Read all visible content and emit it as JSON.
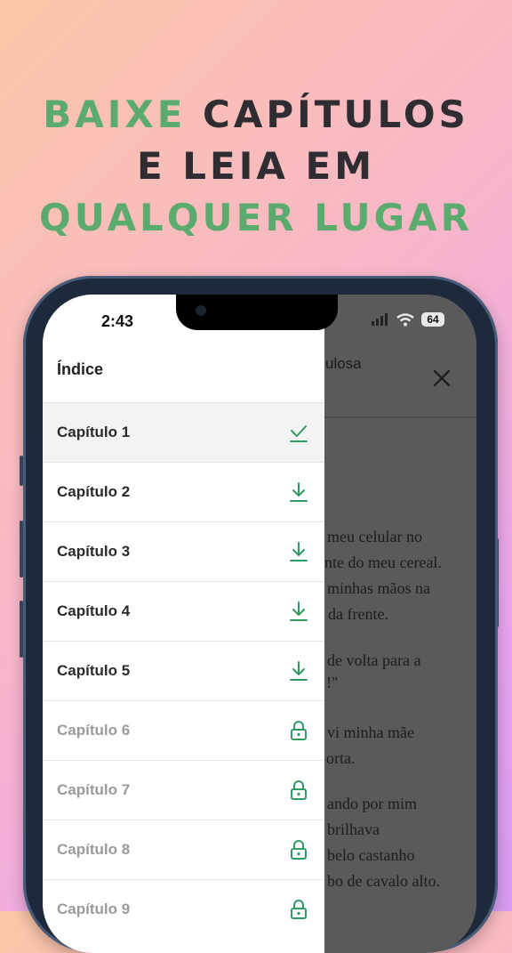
{
  "headline": {
    "line1_accent": "BAIXE",
    "line1_rest": " CAPÍTULOS",
    "line2": "E LEIA EM",
    "line3": "QUALQUER LUGAR"
  },
  "colors": {
    "accent_green": "#5bab6e",
    "dark_text": "#2f2d32"
  },
  "status_bar": {
    "time": "2:43",
    "battery": "64"
  },
  "drawer": {
    "title": "Índice",
    "chapters": [
      {
        "label": "Capítulo 1",
        "state": "downloaded",
        "icon": "check-icon"
      },
      {
        "label": "Capítulo 2",
        "state": "download",
        "icon": "download-icon"
      },
      {
        "label": "Capítulo 3",
        "state": "download",
        "icon": "download-icon"
      },
      {
        "label": "Capítulo 4",
        "state": "download",
        "icon": "download-icon"
      },
      {
        "label": "Capítulo 5",
        "state": "download",
        "icon": "download-icon"
      },
      {
        "label": "Capítulo 6",
        "state": "locked",
        "icon": "lock-icon"
      },
      {
        "label": "Capítulo 7",
        "state": "locked",
        "icon": "lock-icon"
      },
      {
        "label": "Capítulo 8",
        "state": "locked",
        "icon": "lock-icon"
      },
      {
        "label": "Capítulo 9",
        "state": "locked",
        "icon": "lock-icon"
      }
    ]
  },
  "reader": {
    "title_fragment": "ulosa",
    "lines": [
      "meu celular no",
      "nte do meu cereal.",
      "minhas mãos na",
      "da frente.",
      "de volta para a",
      "!\"",
      "vi minha mãe",
      "orta.",
      "ando por mim",
      "brilhava",
      "belo castanho",
      "bo de cavalo alto."
    ]
  }
}
